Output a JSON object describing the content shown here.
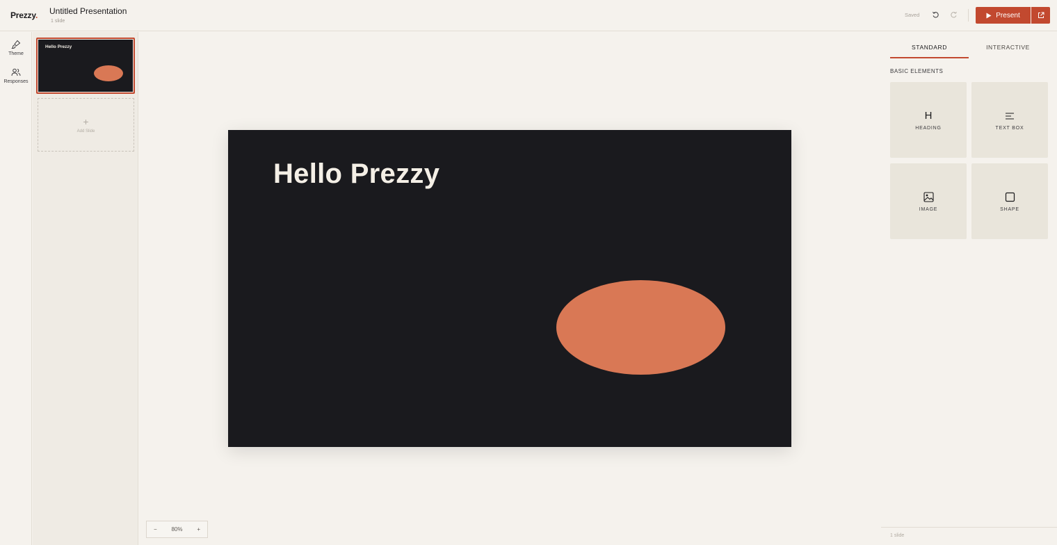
{
  "app": {
    "logo": "Prezzy",
    "logo_dot": "."
  },
  "document": {
    "title": "Untitled Presentation",
    "slide_count_label": "1 slide"
  },
  "toolbar": {
    "saved_label": "Saved",
    "present_label": "Present"
  },
  "rail": {
    "theme_label": "Theme",
    "responses_label": "Responses"
  },
  "slides_panel": {
    "thumbnails": [
      {
        "title": "Hello Prezzy"
      }
    ],
    "add_slide_plus": "+",
    "add_slide_label": "Add Slide"
  },
  "slide": {
    "title": "Hello Prezzy",
    "accent_color": "#d97855",
    "background": "#1a1a1e"
  },
  "zoom": {
    "minus": "−",
    "value": "80%",
    "plus": "+"
  },
  "right_panel": {
    "tabs": [
      {
        "label": "STANDARD",
        "active": true
      },
      {
        "label": "INTERACTIVE",
        "active": false
      }
    ],
    "section_label": "BASIC ELEMENTS",
    "elements": [
      {
        "label": "HEADING",
        "icon": "heading-icon",
        "glyph": "H"
      },
      {
        "label": "TEXT BOX",
        "icon": "text-lines-icon"
      },
      {
        "label": "IMAGE",
        "icon": "image-icon"
      },
      {
        "label": "SHAPE",
        "icon": "square-icon"
      }
    ],
    "footer_count": "1 slide"
  },
  "colors": {
    "brand": "#c2492f",
    "accent": "#d97855"
  }
}
